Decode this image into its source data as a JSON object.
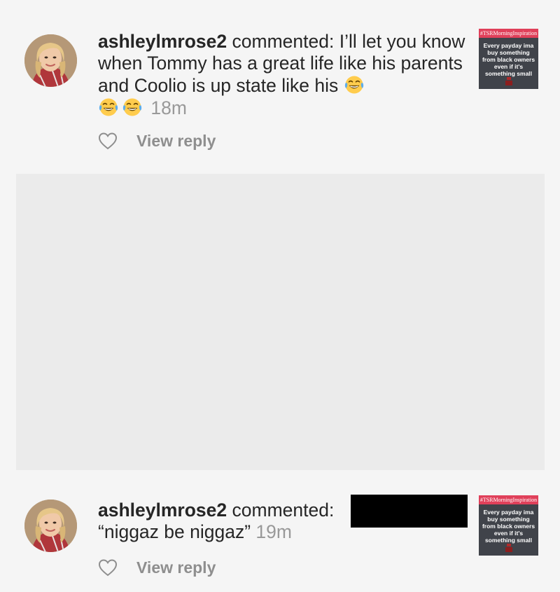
{
  "notifications": [
    {
      "username": "ashleylmrose2",
      "action": "commented:",
      "comment": "I’ll let you know when Tommy has a great life like his parents and Coolio is up state like his",
      "emoji": [
        "face-with-tears-of-joy",
        "face-with-tears-of-joy",
        "face-with-tears-of-joy"
      ],
      "time": "18m",
      "reply_label": "View reply",
      "thumbnail": {
        "hashtag": "#TSRMorningInspiration",
        "text": "Every payday ima buy something from black owners even if it's something small"
      }
    },
    {
      "username": "ashleylmrose2",
      "action": "commented:",
      "comment": "“niggaz be niggaz”",
      "time": "19m",
      "reply_label": "View reply",
      "thumbnail": {
        "hashtag": "#TSRMorningInspiration",
        "text": "Every payday ima buy something from black owners even if it's something small"
      }
    }
  ],
  "colors": {
    "background": "#f5f5f5",
    "text": "#262626",
    "muted": "#999999",
    "placeholder": "#ebebeb",
    "thumb_header": "#e0405a",
    "thumb_bg": "#40434a"
  }
}
